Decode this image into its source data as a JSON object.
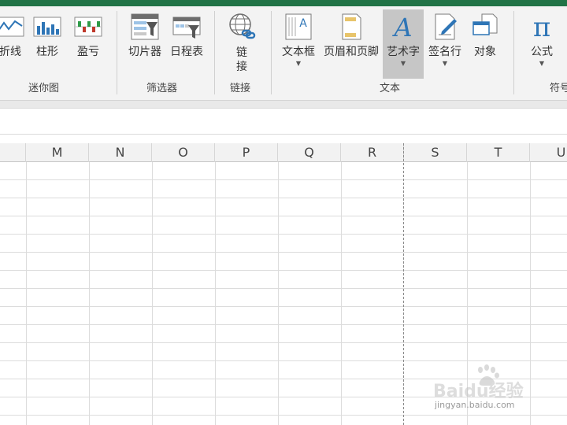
{
  "ribbon": {
    "groups": {
      "sparklines": {
        "label": "迷你图",
        "buttons": [
          {
            "label": "折线"
          },
          {
            "label": "柱形"
          },
          {
            "label": "盈亏"
          }
        ]
      },
      "filters": {
        "label": "筛选器",
        "buttons": [
          {
            "label": "切片器"
          },
          {
            "label": "日程表"
          }
        ]
      },
      "links": {
        "label": "链接",
        "buttons": [
          {
            "label": "链\n接"
          }
        ]
      },
      "text": {
        "label": "文本",
        "buttons": [
          {
            "label": "文本框"
          },
          {
            "label": "页眉和页脚"
          },
          {
            "label": "艺术字"
          },
          {
            "label": "签名行"
          },
          {
            "label": "对象"
          }
        ]
      },
      "symbols": {
        "label": "符号",
        "buttons": [
          {
            "label": "公式"
          }
        ]
      }
    },
    "accent": "#217346"
  },
  "sheet": {
    "columns": [
      "M",
      "N",
      "O",
      "P",
      "Q",
      "R",
      "S",
      "T",
      "U"
    ]
  },
  "watermark": {
    "brand": "Baidu经验",
    "url": "jingyan.baidu.com"
  }
}
